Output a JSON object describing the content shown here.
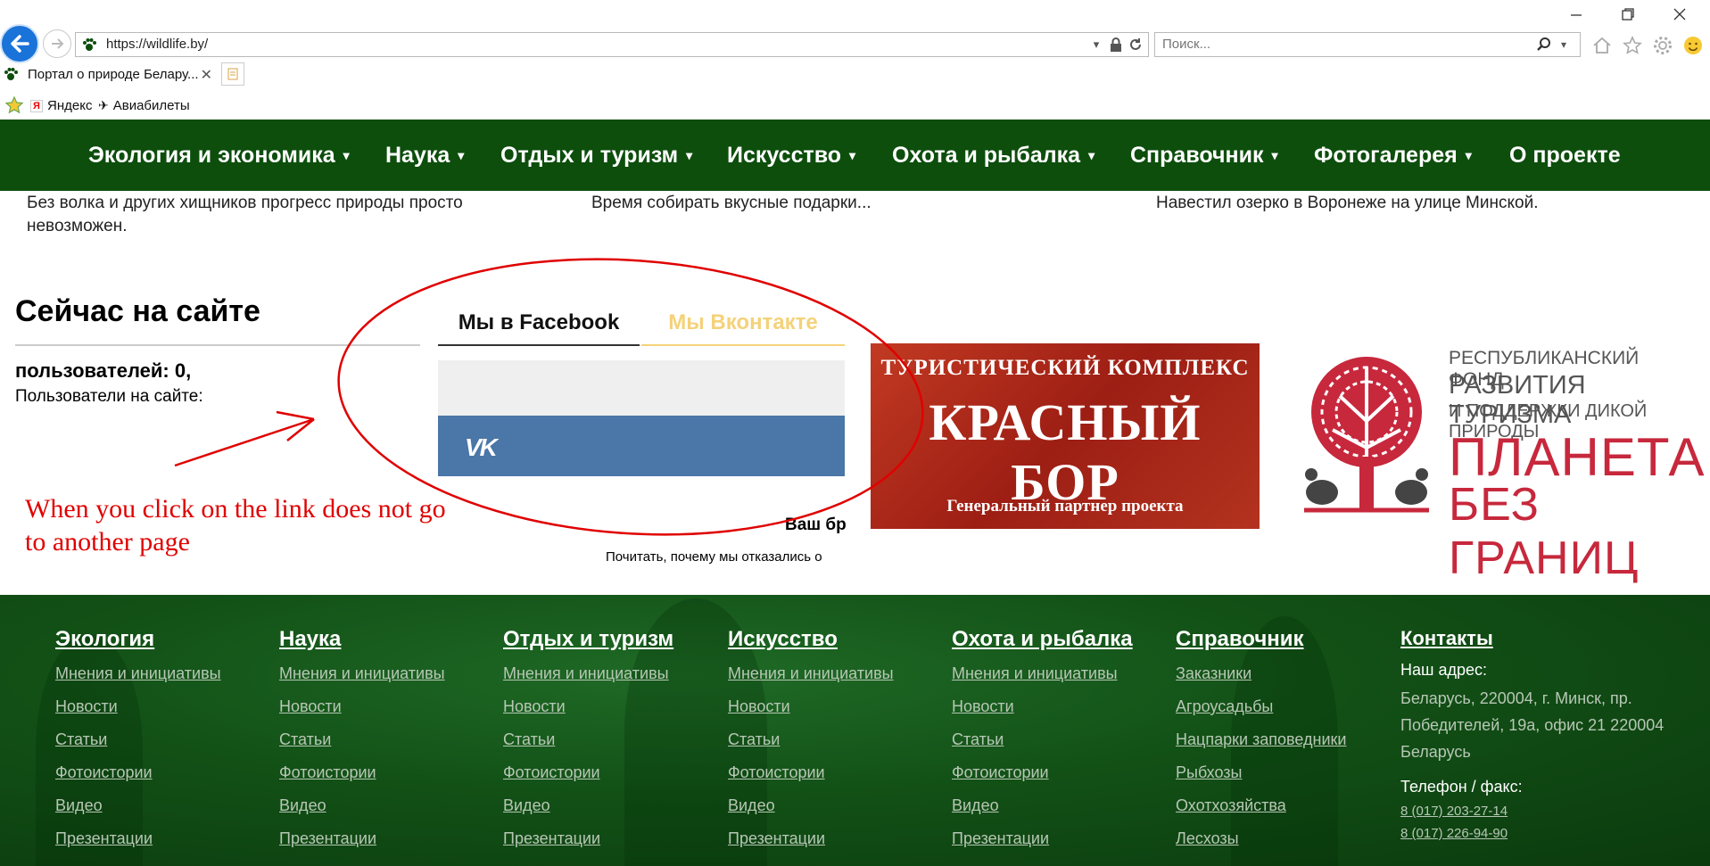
{
  "browser": {
    "url": "https://wildlife.by/",
    "search_placeholder": "Поиск...",
    "tab_title": "Портал о природе Белару...",
    "favorites": [
      "Яндекс",
      "Авиабилеты"
    ]
  },
  "nav": {
    "items": [
      {
        "label": "Экология и экономика",
        "caret": "▾"
      },
      {
        "label": "Наука",
        "caret": "▾"
      },
      {
        "label": "Отдых и туризм",
        "caret": "▾"
      },
      {
        "label": "Искусство",
        "caret": "▾"
      },
      {
        "label": "Охота и рыбалка",
        "caret": "▾"
      },
      {
        "label": "Справочник",
        "caret": "▾"
      },
      {
        "label": "Фотогалерея",
        "caret": "▾"
      },
      {
        "label": "О проекте",
        "caret": ""
      }
    ]
  },
  "snippets": [
    "Без волка и других хищников прогресс природы просто невозможен.",
    "Время собирать вкусные подарки...",
    "Навестил озерко в Воронеже на улице Минской."
  ],
  "online": {
    "title": "Сейчас на сайте",
    "users": "пользователей: 0,",
    "label": "Пользователи на сайте:"
  },
  "social": {
    "tab_facebook": "Мы в Facebook",
    "tab_vk": "Мы Вконтакте",
    "vk_logo": "VK",
    "vash": "Ваш бр",
    "pochitat": "Почитать, почему мы отказались о"
  },
  "banners": {
    "bor": {
      "line1": "ТУРИСТИЧЕСКИЙ КОМПЛЕКС",
      "line2": "КРАСНЫЙ БОР",
      "line3": "Генеральный партнер проекта"
    },
    "planet": {
      "line1": "РЕСПУБЛИКАНСКИЙ ФОНД",
      "line2": "РАЗВИТИЯ ТУРИЗМА",
      "line3": "И ПОДДЕРЖКИ ДИКОЙ ПРИРОДЫ",
      "line4": "ПЛАНЕТА",
      "line5": "БЕЗ ГРАНИЦ"
    }
  },
  "annotation": {
    "text": "When you click on the link does not go to another page",
    "color": "#e00000"
  },
  "footer": {
    "columns": [
      {
        "heading": "Экология",
        "links": [
          "Мнения и инициативы",
          "Новости",
          "Статьи",
          "Фотоистории",
          "Видео",
          "Презентации"
        ]
      },
      {
        "heading": "Наука",
        "links": [
          "Мнения и инициативы",
          "Новости",
          "Статьи",
          "Фотоистории",
          "Видео",
          "Презентации"
        ]
      },
      {
        "heading": "Отдых и туризм",
        "links": [
          "Мнения и инициативы",
          "Новости",
          "Статьи",
          "Фотоистории",
          "Видео",
          "Презентации"
        ]
      },
      {
        "heading": "Искусство",
        "links": [
          "Мнения и инициативы",
          "Новости",
          "Статьи",
          "Фотоистории",
          "Видео",
          "Презентации"
        ]
      },
      {
        "heading": "Охота и рыбалка",
        "links": [
          "Мнения и инициативы",
          "Новости",
          "Статьи",
          "Фотоистории",
          "Видео",
          "Презентации"
        ]
      },
      {
        "heading": "Справочник",
        "links": [
          "Заказники",
          "Агроусадьбы",
          "Нацпарки заповедники",
          "Рыбхозы",
          "Охотхозяйства",
          "Лесхозы"
        ]
      }
    ],
    "contacts": {
      "heading": "Контакты",
      "address_label": "Наш адрес:",
      "address": "Беларусь, 220004, г. Минск, пр. Победителей, 19а, офис 21 220004 Беларусь",
      "phone_label": "Телефон / факс:",
      "phones": [
        "8 (017) 203-27-14",
        "8 (017) 226-94-90"
      ]
    }
  },
  "colors": {
    "nav_bg": "#0d4e0d",
    "vk_blue": "#4a76a8",
    "vk_tab": "#f4d27a",
    "planet_red": "#c7283c",
    "bor_red": "#b02419"
  }
}
